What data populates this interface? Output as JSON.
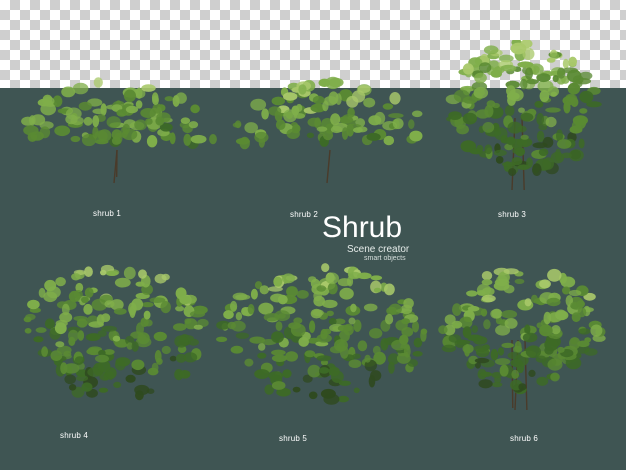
{
  "labels": {
    "shrub1": "shrub 1",
    "shrub2": "shrub 2",
    "shrub3": "shrub 3",
    "shrub4": "shrub 4",
    "shrub5": "shrub 5",
    "shrub6": "shrub 6"
  },
  "title": {
    "main": "Shrub",
    "line1": "Scene creator",
    "line2": "smart objects"
  },
  "colors": {
    "background": "#3f5553",
    "checker_light": "#ffffff",
    "checker_dark": "#cfcfcf",
    "foliage": [
      "#2f4a1f",
      "#3d6a26",
      "#5a8a33",
      "#7fae4a",
      "#a9c96a"
    ]
  }
}
